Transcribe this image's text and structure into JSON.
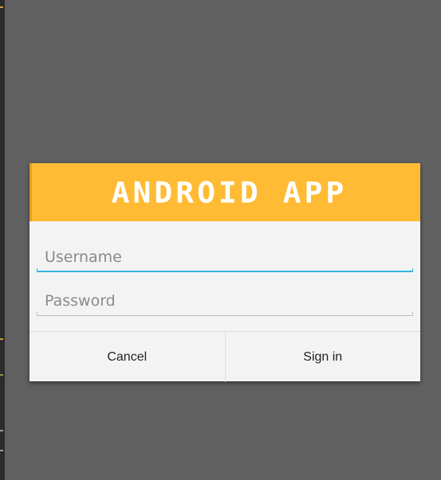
{
  "dialog": {
    "title": "ANDROID APP",
    "username": {
      "placeholder": "Username",
      "value": ""
    },
    "password": {
      "placeholder": "Password",
      "value": ""
    },
    "buttons": {
      "cancel_label": "Cancel",
      "signin_label": "Sign in"
    }
  },
  "colors": {
    "background": "#606060",
    "header": "#ffbb33",
    "dialog": "#f3f3f3",
    "focus_accent": "#33b5e5"
  }
}
